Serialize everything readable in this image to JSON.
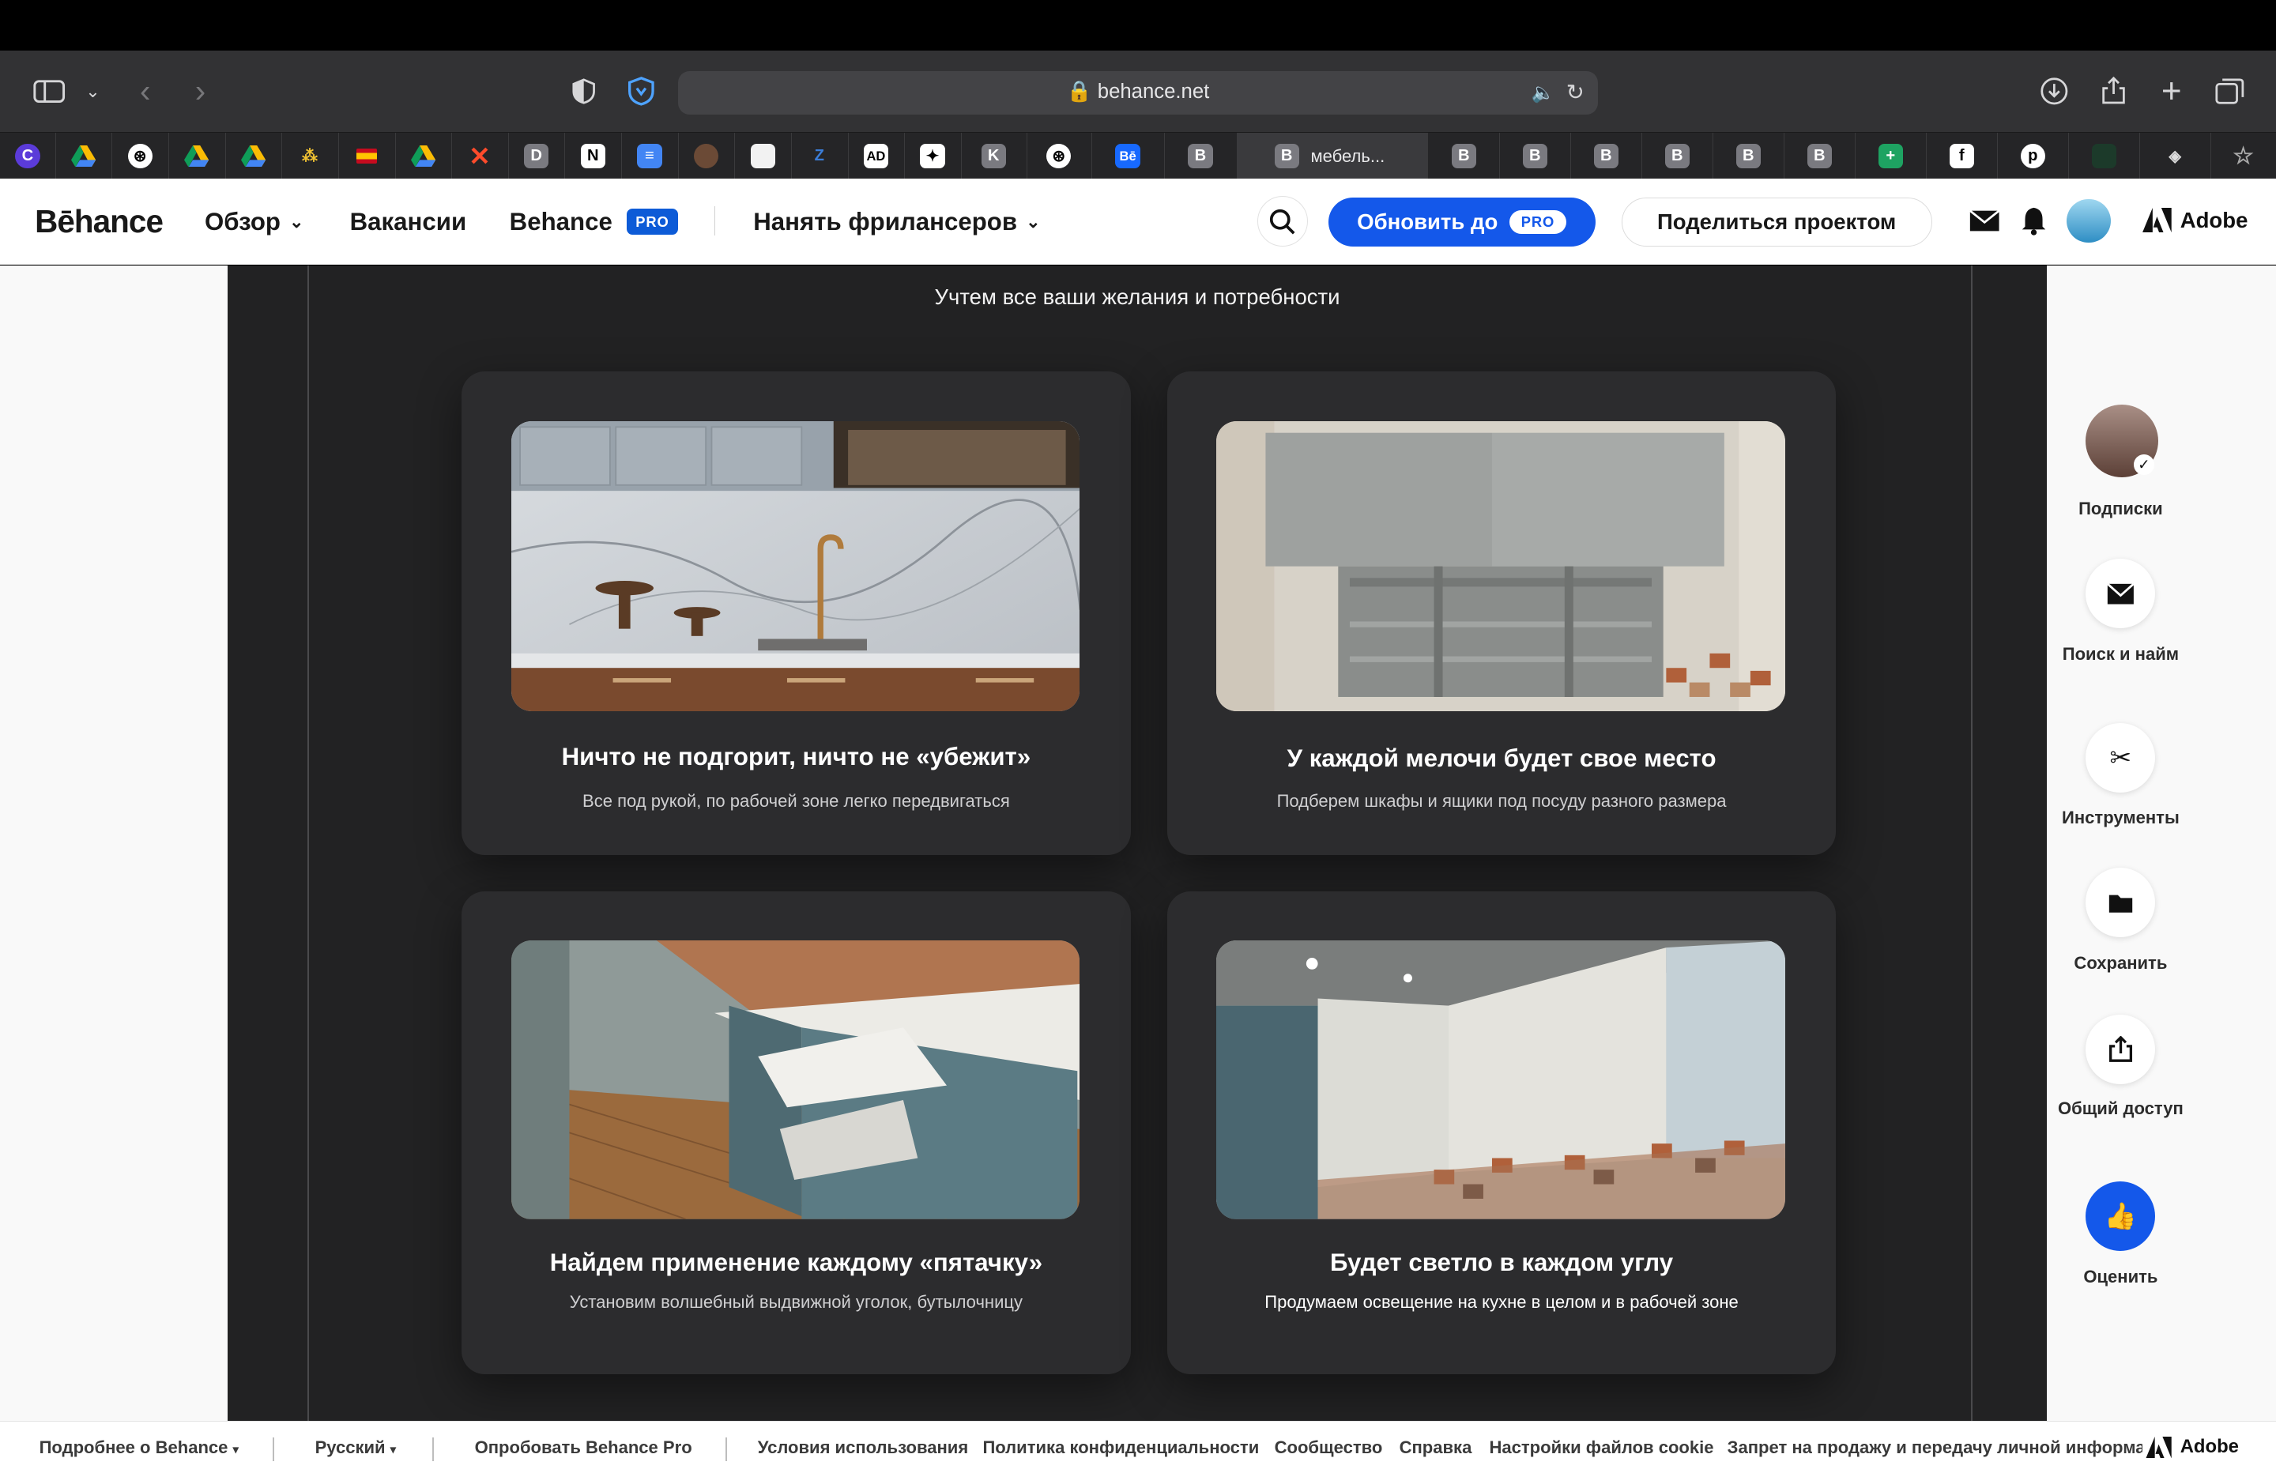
{
  "browser": {
    "url": "behance.net",
    "active_tab_label": "мебель...",
    "tab_letters": [
      "",
      "",
      "",
      "",
      "",
      "",
      "",
      "",
      "",
      "D",
      "",
      "",
      "",
      "",
      "Z",
      "AD",
      "",
      "K",
      "",
      "Bē",
      "B"
    ],
    "right_tab_letters": [
      "B",
      "B",
      "B",
      "B",
      "B",
      "B",
      "",
      "",
      "",
      "",
      ""
    ]
  },
  "header": {
    "logo": "Bēhance",
    "nav_explore": "Обзор",
    "nav_jobs": "Вакансии",
    "nav_behance": "Behance",
    "pro_badge": "PRO",
    "nav_hire": "Нанять фрилансеров",
    "upgrade_label": "Обновить до",
    "share_project": "Поделиться проектом",
    "adobe": "Adobe"
  },
  "project": {
    "subtitle": "Учтем все ваши желания и потребности",
    "cards": [
      {
        "title": "Ничто не подгорит, ничто не «убежит»",
        "desc": "Все под рукой, по рабочей зоне легко передвигаться"
      },
      {
        "title": "У каждой мелочи будет свое место",
        "desc": "Подберем шкафы и ящики под посуду разного размера"
      },
      {
        "title": "Найдем применение каждому «пятачку»",
        "desc": "Установим волшебный выдвижной уголок, бутылочницу"
      },
      {
        "title": "Будет светло в каждом углу",
        "desc": "Продумаем освещение на кухне в целом и в рабочей зоне"
      }
    ]
  },
  "rail": {
    "follow": "Подписки",
    "hire": "Поиск и найм",
    "tools": "Инструменты",
    "save": "Сохранить",
    "share": "Общий доступ",
    "appreciate": "Оценить"
  },
  "footer": {
    "about": "Подробнее о Behance",
    "language": "Русский",
    "try_pro": "Опробовать Behance Pro",
    "terms": "Условия использования",
    "privacy": "Политика конфиденциальности",
    "community": "Сообщество",
    "help": "Справка",
    "cookies": "Настройки файлов cookie",
    "do_not_sell": "Запрет на продажу и передачу личной информации",
    "adobe": "Adobe"
  }
}
